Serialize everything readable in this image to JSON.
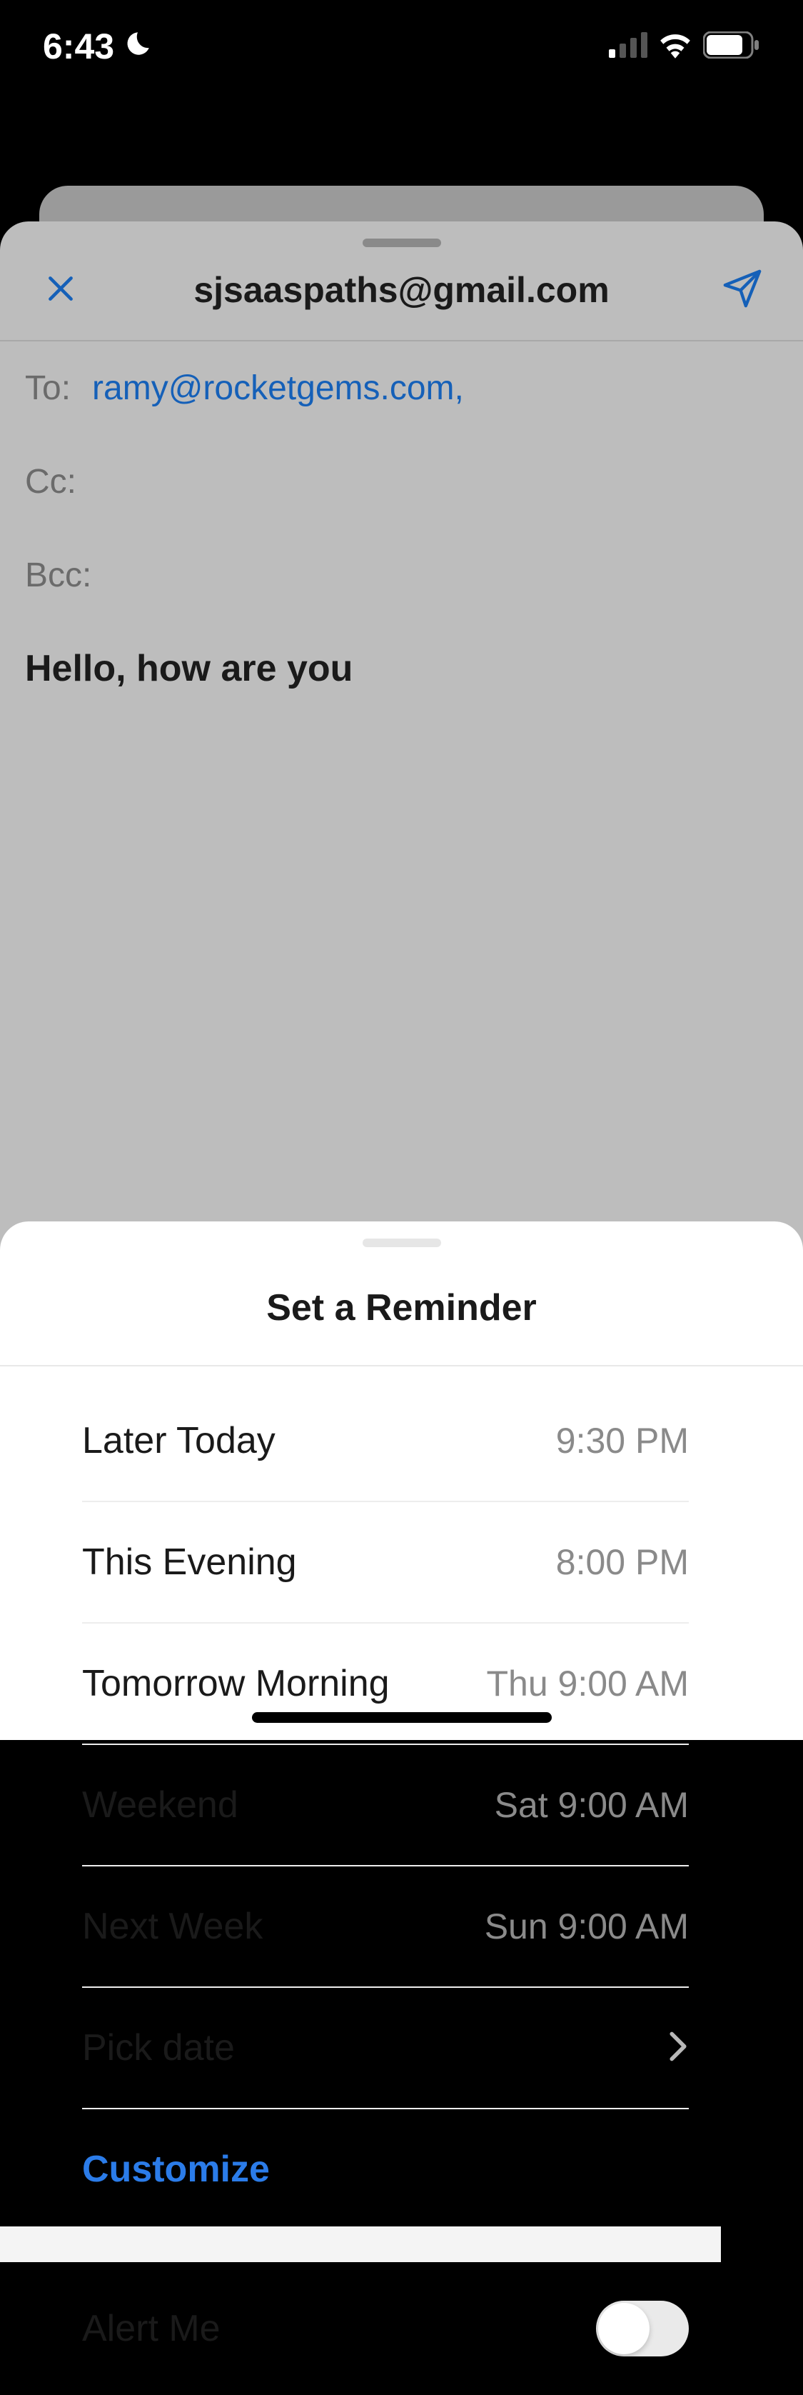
{
  "statusBar": {
    "time": "6:43"
  },
  "compose": {
    "title": "sjsaaspaths@gmail.com",
    "toLabel": "To:",
    "toValue": "ramy@rocketgems.com,",
    "ccLabel": "Cc:",
    "bccLabel": "Bcc:",
    "subject": "Hello, how are you"
  },
  "reminder": {
    "title": "Set a Reminder",
    "items": [
      {
        "label": "Later Today",
        "time": "9:30 PM"
      },
      {
        "label": "This Evening",
        "time": "8:00 PM"
      },
      {
        "label": "Tomorrow Morning",
        "time": "Thu 9:00 AM"
      },
      {
        "label": "Weekend",
        "time": "Sat 9:00 AM"
      },
      {
        "label": "Next Week",
        "time": "Sun 9:00 AM"
      }
    ],
    "pickDate": "Pick date",
    "customize": "Customize",
    "alertMe": "Alert Me"
  }
}
